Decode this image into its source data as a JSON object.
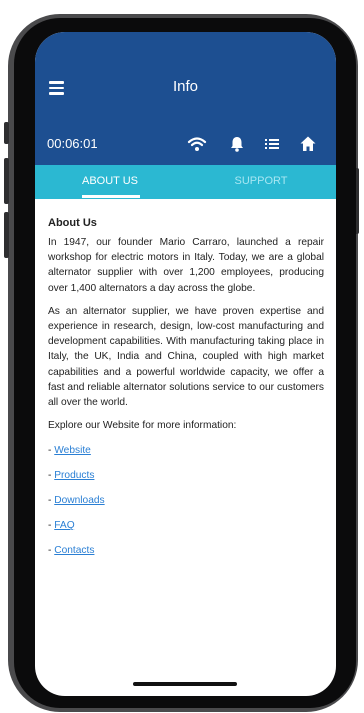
{
  "header": {
    "title": "Info"
  },
  "status": {
    "timer": "00:06:01"
  },
  "tabs": [
    {
      "label": "ABOUT US"
    },
    {
      "label": "SUPPORT"
    }
  ],
  "content": {
    "heading": "About Us",
    "paragraphs": [
      "In 1947, our founder Mario Carraro, launched a repair workshop for electric motors in Italy. Today, we are a global alternator supplier with over 1,200 employees, producing over 1,400 alternators a day across the globe.",
      "As an alternator supplier, we have proven expertise and experience in research, design, low-cost manufacturing and development capabilities. With manufacturing taking place in Italy, the UK, India and China, coupled with high market capabilities and a powerful worldwide capacity, we offer a fast and reliable alternator solutions service to our customers all over the world."
    ],
    "explore": "Explore our Website for more information:",
    "link_prefix": "- ",
    "links": [
      {
        "label": "Website"
      },
      {
        "label": "Products"
      },
      {
        "label": "Downloads"
      },
      {
        "label": "FAQ"
      },
      {
        "label": "Contacts"
      }
    ]
  },
  "colors": {
    "header": "#1d4f91",
    "tabbar": "#2bb8d2",
    "link": "#2a7fd4"
  },
  "icons": [
    "menu-icon",
    "wifi-icon",
    "bell-icon",
    "list-icon",
    "home-icon"
  ]
}
